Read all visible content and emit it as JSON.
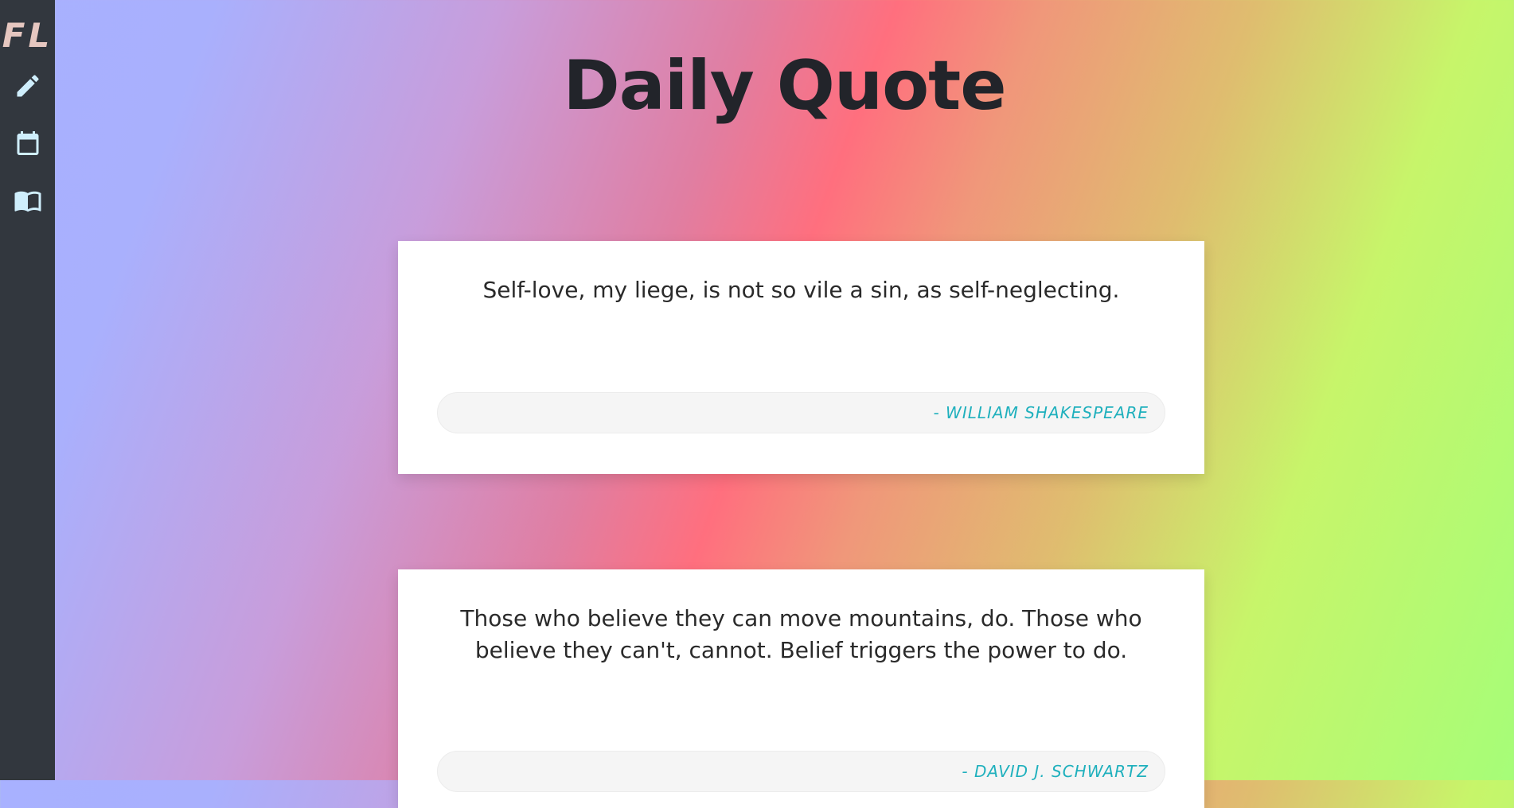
{
  "sidebar": {
    "logo": "FL",
    "items": [
      {
        "icon": "pencil-icon"
      },
      {
        "icon": "calendar-icon"
      },
      {
        "icon": "book-icon"
      }
    ],
    "icon_color": "#cfeefc"
  },
  "page": {
    "title": "Daily Quote"
  },
  "quotes": [
    {
      "text": "Self-love, my liege, is not so vile a sin, as self-neglecting.",
      "author": "- William Shakespeare"
    },
    {
      "text": "Those who believe they can move mountains, do. Those who believe they can't, cannot. Belief triggers the power to do.",
      "author": "- David J. Schwartz"
    }
  ],
  "colors": {
    "sidebar": "#32373e",
    "author_accent": "#1fb0bd"
  }
}
